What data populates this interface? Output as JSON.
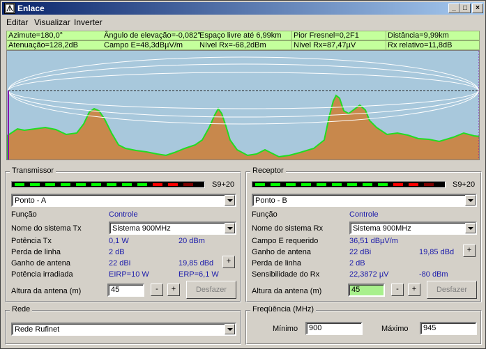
{
  "window": {
    "title": "Enlace",
    "minimize": "_",
    "maximize": "□",
    "close": "×"
  },
  "menu": [
    {
      "label": "Editar"
    },
    {
      "label": "Visualizar"
    },
    {
      "label": "Inverter"
    }
  ],
  "status_row1": {
    "azimute": "Azimute=180,0°",
    "angulo": "Ângulo de elevação=-0,082°",
    "espaco": "Espaço livre até 6,99km",
    "fresnel": "Pior Fresnel=0,2F1",
    "distancia": "Distância=9,99km"
  },
  "status_row2": {
    "atenuacao": "Atenuação=128,2dB",
    "campo": "Campo E=48,3dBµV/m",
    "nivel_dbm": "Nível Rx=-68,2dBm",
    "nivel_uv": "Nível Rx=87,47µV",
    "rx_relativo": "Rx relativo=11,8dB"
  },
  "colors": {
    "status_bg": "#c4ff9c",
    "sky": "#a8c8dc",
    "terrain": "#c8884c",
    "terrain_edge": "#22dd22",
    "value_text": "#1a1aaa"
  },
  "transmitter": {
    "group_title": "Transmissor",
    "meter_label": "S9+20",
    "site": "Ponto - A",
    "funcao_label": "Função",
    "funcao_value": "Controle",
    "sistema_label": "Nome do sistema Tx",
    "sistema_value": "Sistema  900MHz",
    "potencia_label": "Potência Tx",
    "potencia_w": "0,1 W",
    "potencia_dbm": "20 dBm",
    "perda_label": "Perda de linha",
    "perda_value": "2 dB",
    "ganho_label": "Ganho de antena",
    "ganho_dbi": "22 dBi",
    "ganho_dbd": "19,85 dBd",
    "irradiada_label": "Potência irradiada",
    "eirp": "EIRP=10 W",
    "erp": "ERP=6,1 W",
    "altura_label": "Altura da antena (m)",
    "altura_value": "45",
    "minus": "-",
    "plus": "+",
    "desfazer": "Desfazer"
  },
  "receiver": {
    "group_title": "Receptor",
    "meter_label": "S9+20",
    "site": "Ponto - B",
    "funcao_label": "Função",
    "funcao_value": "Controle",
    "sistema_label": "Nome do sistema Rx",
    "sistema_value": "Sistema  900MHz",
    "campo_label": "Campo E requerido",
    "campo_value": "36,51 dBµV/m",
    "ganho_label": "Ganho de antena",
    "ganho_dbi": "22 dBi",
    "ganho_dbd": "19,85 dBd",
    "perda_label": "Perda de linha",
    "perda_value": "2 dB",
    "sens_label": "Sensibilidade do Rx",
    "sens_uv": "22,3872 µV",
    "sens_dbm": "-80 dBm",
    "altura_label": "Altura da antena (m)",
    "altura_value": "45",
    "minus": "-",
    "plus": "+",
    "desfazer": "Desfazer"
  },
  "network": {
    "group_title": "Rede",
    "value": "Rede Rufinet"
  },
  "frequency": {
    "group_title": "Freqüência (MHz)",
    "min_label": "Mínimo",
    "min_value": "900",
    "max_label": "Máximo",
    "max_value": "945"
  }
}
